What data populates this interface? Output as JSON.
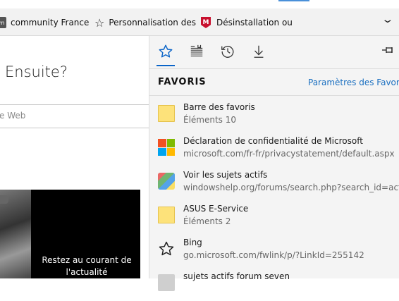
{
  "favorites_bar": {
    "items": [
      {
        "label": "community France",
        "icon": "site-icon"
      },
      {
        "label": "Personnalisation des",
        "icon": "star-icon"
      },
      {
        "label": "Désinstallation ou",
        "icon": "mcafee-icon"
      }
    ],
    "overflow_icon": "chevron-down-icon"
  },
  "page": {
    "heading": "Ensuite?",
    "search_placeholder": "e Web",
    "promo_text": "Restez au courant de l'actualité"
  },
  "hub": {
    "tabs": [
      {
        "name": "favorites",
        "icon": "star-icon",
        "active": true
      },
      {
        "name": "reading-list",
        "icon": "reading-list-icon",
        "active": false
      },
      {
        "name": "history",
        "icon": "history-icon",
        "active": false
      },
      {
        "name": "downloads",
        "icon": "download-icon",
        "active": false
      }
    ],
    "pin_icon": "pin-icon",
    "title": "FAVORIS",
    "settings_link": "Paramètres des Favoris",
    "items": [
      {
        "title": "Barre des favoris",
        "subtitle": "Éléments 10",
        "icon": "folder-icon"
      },
      {
        "title": "Déclaration de confidentialité de Microsoft",
        "subtitle": "microsoft.com/fr-fr/privacystatement/default.aspx",
        "icon": "microsoft-logo-icon"
      },
      {
        "title": "Voir les sujets actifs",
        "subtitle": "windowshelp.org/forums/search.php?search_id=activ",
        "icon": "windowshelp-icon"
      },
      {
        "title": "ASUS E-Service",
        "subtitle": "Éléments 2",
        "icon": "folder-icon"
      },
      {
        "title": "Bing",
        "subtitle": "go.microsoft.com/fwlink/p/?LinkId=255142",
        "icon": "star-icon"
      },
      {
        "title": "sujets actifs forum seven",
        "subtitle": "",
        "icon": "site-icon"
      }
    ]
  },
  "colors": {
    "accent": "#0a64c8",
    "link": "#1a6fc0",
    "hub_background": "#f4f4f4"
  }
}
